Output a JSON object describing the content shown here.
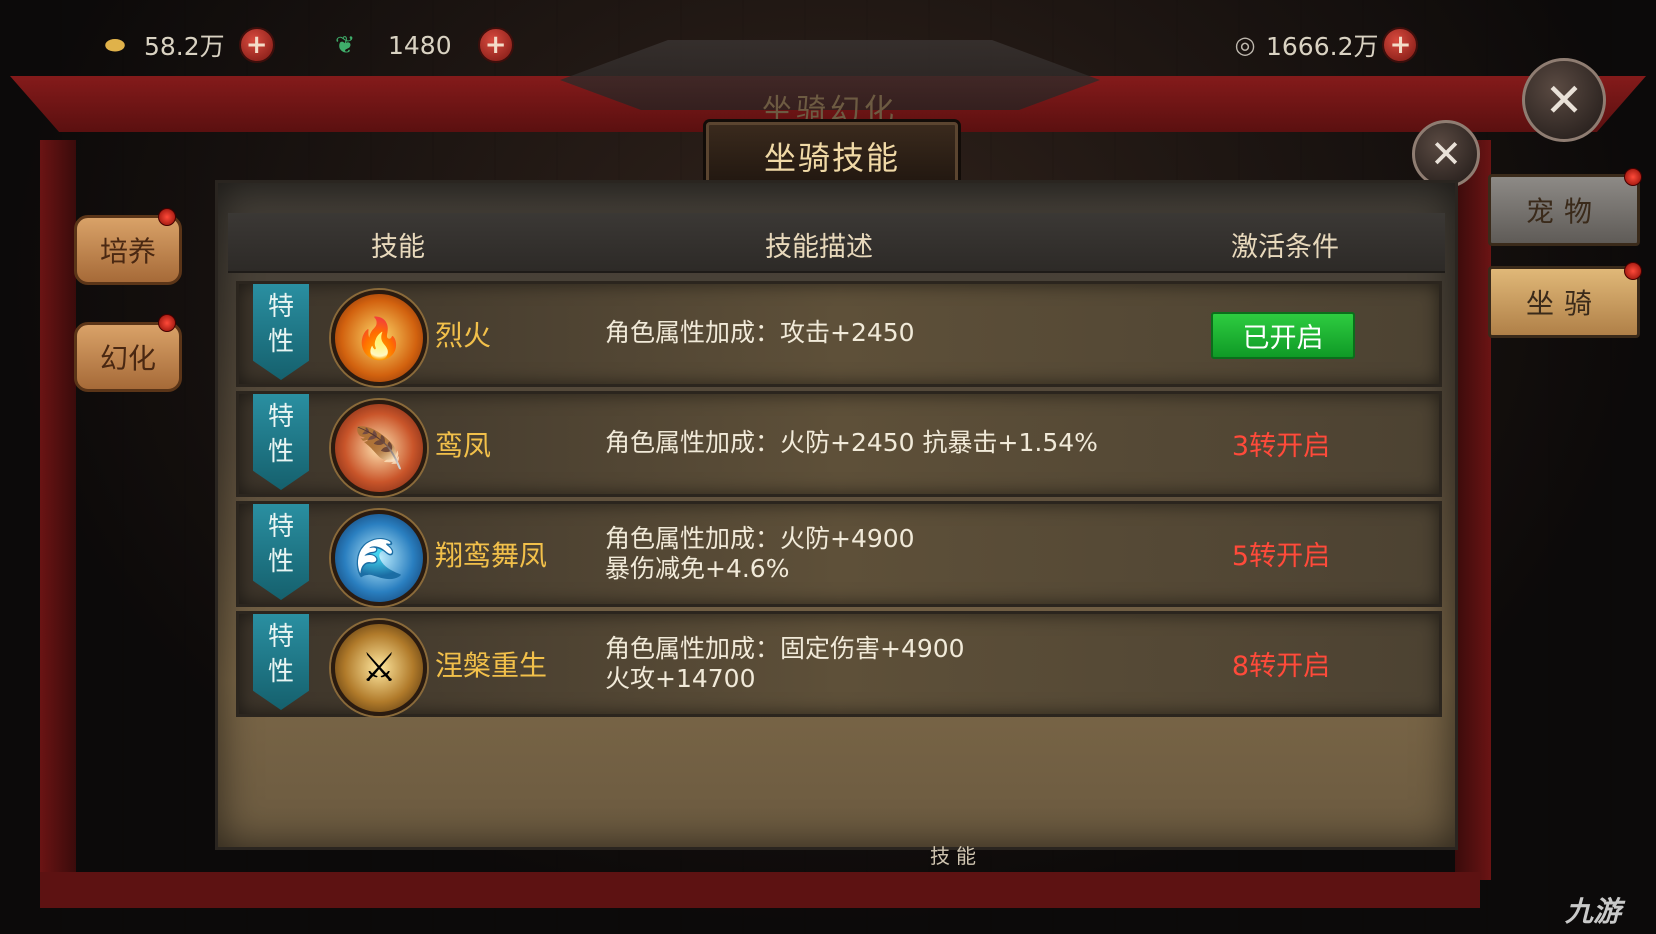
{
  "currency": {
    "gold_icon": "gold-ingot-icon",
    "gold_value": "58.2万",
    "jade_icon": "jade-icon",
    "jade_value": "1480",
    "coin_icon": "coin-icon",
    "coin_value": "1666.2万",
    "plus_label": "+"
  },
  "background_title": "坐骑幻化",
  "title": "坐骑技能",
  "close_label": "✕",
  "header": {
    "skill": "技能",
    "description": "技能描述",
    "condition": "激活条件"
  },
  "skills": [
    {
      "tag_line1": "特",
      "tag_line2": "性",
      "icon": "fire-phoenix-icon",
      "name": "烈火",
      "desc_line1": "角色属性加成：攻击+2450",
      "desc_line2": "",
      "condition": "已开启",
      "condition_active": true
    },
    {
      "tag_line1": "特",
      "tag_line2": "性",
      "icon": "phoenix-wing-icon",
      "name": "鸾凤",
      "desc_line1": "角色属性加成：火防+2450 抗暴击+1.54%",
      "desc_line2": "",
      "condition": "3转开启",
      "condition_active": false
    },
    {
      "tag_line1": "特",
      "tag_line2": "性",
      "icon": "water-wave-icon",
      "name": "翔鸾舞凤",
      "desc_line1": "角色属性加成：火防+4900",
      "desc_line2": "暴伤减免+4.6%",
      "condition": "5转开启",
      "condition_active": false
    },
    {
      "tag_line1": "特",
      "tag_line2": "性",
      "icon": "rebirth-warrior-icon",
      "name": "涅槃重生",
      "desc_line1": "角色属性加成：固定伤害+4900",
      "desc_line2": "火攻+14700",
      "condition": "8转开启",
      "condition_active": false
    }
  ],
  "left_tabs": [
    "培养",
    "幻化"
  ],
  "right_tabs": [
    "宠物",
    "坐骑"
  ],
  "bottom_label": "技能",
  "watermark": "九游",
  "colors": {
    "active_green": "#1fb534",
    "locked_red": "#ff4a3a",
    "skill_name_gold": "#f2c04a",
    "tag_teal": "#1d7c8c"
  }
}
